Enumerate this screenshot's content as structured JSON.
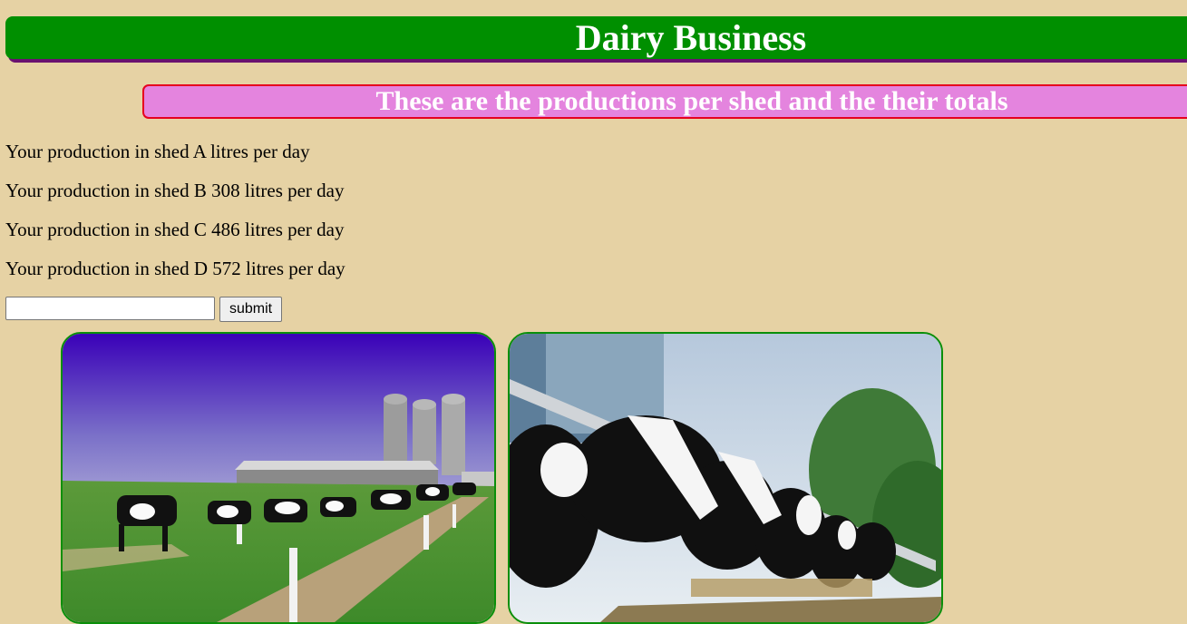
{
  "header": {
    "title": "Dairy Business"
  },
  "subheader": {
    "title": "These are the productions per shed and the their totals"
  },
  "productions": [
    "Your production in shed A litres per day",
    "Your production in shed B 308 litres per day",
    "Your production in shed C 486 litres per day",
    "Your production in shed D 572 litres per day"
  ],
  "form": {
    "input_value": "",
    "submit_label": "submit"
  },
  "images": [
    {
      "icon": "cows-walking-farm-photo"
    },
    {
      "icon": "cows-feeding-photo"
    }
  ],
  "colors": {
    "background": "#e6d2a4",
    "header": "#008f00",
    "subheader": "#e484de",
    "subheader_border": "#e6001f",
    "image_border": "#0a8f0a"
  }
}
